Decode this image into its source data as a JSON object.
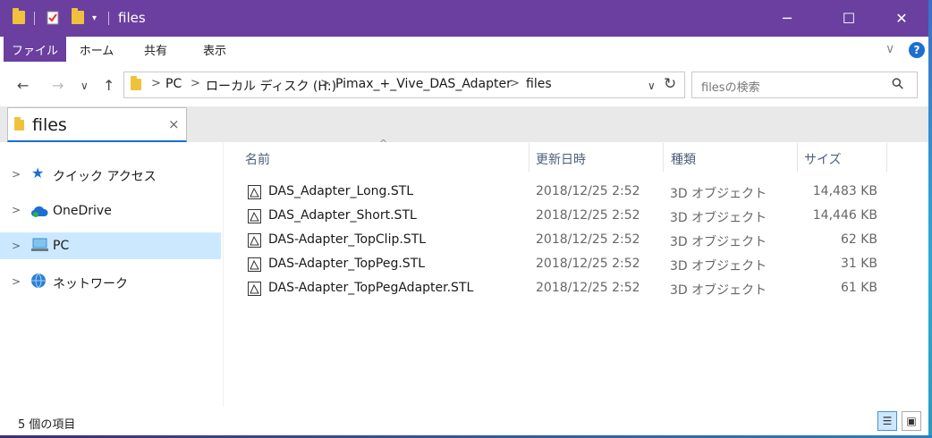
{
  "window": {
    "title": "files",
    "minimize_glyph": "─",
    "maximize_glyph": "☐",
    "close_glyph": "✕"
  },
  "ribbon": {
    "tabs": [
      {
        "label": "ファイル"
      },
      {
        "label": "ホーム"
      },
      {
        "label": "共有"
      },
      {
        "label": "表示"
      }
    ],
    "collapse_glyph": "∨",
    "help_glyph": "?"
  },
  "address": {
    "back_glyph": "←",
    "forward_glyph": "→",
    "recent_glyph": "∨",
    "up_glyph": "↑",
    "separator_glyph": ">",
    "breadcrumbs": [
      "PC",
      "ローカル ディスク (H:)",
      "Pimax_+_Vive_DAS_Adapter",
      "files"
    ],
    "dropdown_glyph": "∨",
    "refresh_glyph": "↻"
  },
  "search": {
    "placeholder": "filesの検索",
    "icon_glyph": "⚲"
  },
  "tab": {
    "title": "files",
    "close_glyph": "×"
  },
  "nav_pane": {
    "expand_glyph": ">",
    "items": [
      {
        "label": "クイック アクセス",
        "icon": "star-icon",
        "selected": false
      },
      {
        "label": "OneDrive",
        "icon": "cloud-icon",
        "selected": false
      },
      {
        "label": "PC",
        "icon": "computer-icon",
        "selected": true
      },
      {
        "label": "ネットワーク",
        "icon": "network-icon",
        "selected": false
      }
    ]
  },
  "file_list": {
    "sort_glyph": "^",
    "columns": [
      "名前",
      "更新日時",
      "種類",
      "サイズ"
    ],
    "rows": [
      {
        "name": "DAS_Adapter_Long.STL",
        "modified": "2018/12/25 2:52",
        "type": "3D オブジェクト",
        "size": "14,483 KB"
      },
      {
        "name": "DAS_Adapter_Short.STL",
        "modified": "2018/12/25 2:52",
        "type": "3D オブジェクト",
        "size": "14,446 KB"
      },
      {
        "name": "DAS-Adapter_TopClip.STL",
        "modified": "2018/12/25 2:52",
        "type": "3D オブジェクト",
        "size": "62 KB"
      },
      {
        "name": "DAS-Adapter_TopPeg.STL",
        "modified": "2018/12/25 2:52",
        "type": "3D オブジェクト",
        "size": "31 KB"
      },
      {
        "name": "DAS-Adapter_TopPegAdapter.STL",
        "modified": "2018/12/25 2:52",
        "type": "3D オブジェクト",
        "size": "61 KB"
      }
    ]
  },
  "status_bar": {
    "item_count": "5 個の項目",
    "details_view_glyph": "☰",
    "large_icons_view_glyph": "▣"
  },
  "colors": {
    "accent": "#6a3fa0",
    "selection": "#cce8ff",
    "link_blue": "#1c6fd1",
    "folder": "#f0c23c"
  }
}
